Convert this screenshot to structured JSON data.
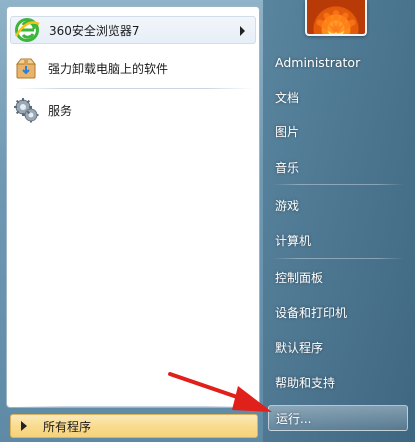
{
  "programs": [
    {
      "label": "360安全浏览器7",
      "icon": "browser-360-icon",
      "has_submenu": true
    },
    {
      "label": "强力卸载电脑上的软件",
      "icon": "uninstall-box-icon",
      "has_submenu": false
    },
    {
      "label": "服务",
      "icon": "gears-icon",
      "has_submenu": false
    }
  ],
  "all_programs_label": "所有程序",
  "user": {
    "name": "Administrator",
    "avatar": "flower-avatar-icon"
  },
  "right_links": [
    {
      "label": "文档"
    },
    {
      "label": "图片"
    },
    {
      "label": "音乐"
    },
    {
      "label": "游戏"
    },
    {
      "label": "计算机"
    },
    {
      "label": "控制面板"
    },
    {
      "label": "设备和打印机"
    },
    {
      "label": "默认程序"
    },
    {
      "label": "帮助和支持"
    },
    {
      "label": "运行..."
    }
  ],
  "colors": {
    "annotation_arrow": "#e0201a",
    "all_programs_bg": "#f9dc8f"
  }
}
